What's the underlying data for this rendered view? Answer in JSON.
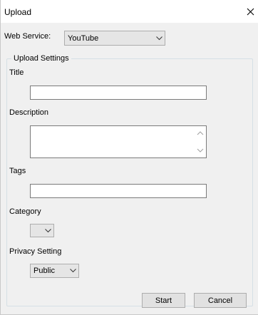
{
  "window": {
    "title": "Upload"
  },
  "web_service": {
    "label": "Web Service:",
    "selected": "YouTube"
  },
  "upload_settings": {
    "group_title": "Upload Settings",
    "title_label": "Title",
    "title_value": "",
    "description_label": "Description",
    "description_value": "",
    "tags_label": "Tags",
    "tags_value": "",
    "category_label": "Category",
    "category_selected": "",
    "privacy_label": "Privacy Setting",
    "privacy_selected": "Public"
  },
  "buttons": {
    "start": "Start",
    "cancel": "Cancel"
  },
  "icons": {
    "close": "close-icon",
    "dropdown": "chevron-down-icon",
    "scroll_up": "chevron-up-icon",
    "scroll_down": "chevron-down-icon"
  },
  "colors": {
    "window_bg": "#f0f0f0",
    "titlebar_bg": "#ffffff",
    "button_bg": "#e1e1e1",
    "border": "#adadad"
  }
}
